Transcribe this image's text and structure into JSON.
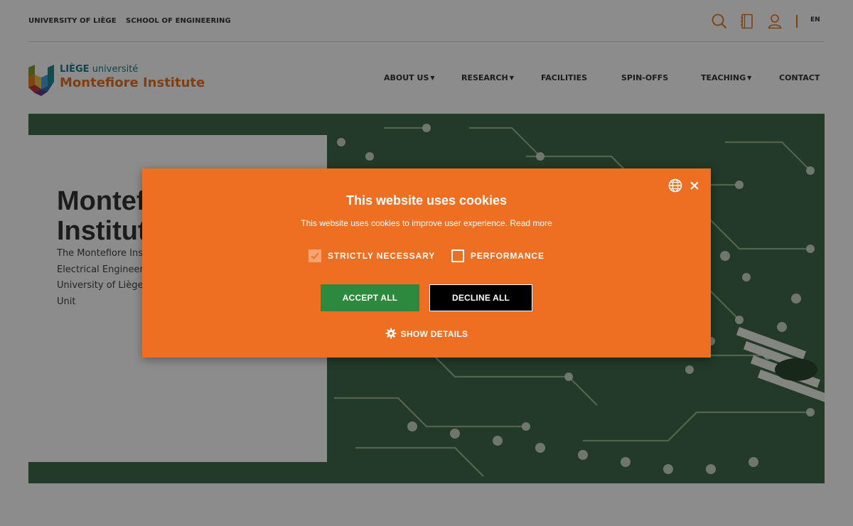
{
  "topbar": {
    "links": [
      "UNIVERSITY OF LIÈGE",
      "SCHOOL OF ENGINEERING"
    ],
    "language": "EN",
    "icons": [
      "search-icon",
      "book-icon",
      "user-icon"
    ],
    "accent_color": "#e07a1c"
  },
  "logo": {
    "university_bold": "LIÈGE",
    "university_rest": " université",
    "institute": "Montefiore Institute",
    "teal_color": "#1b7f86",
    "orange_color": "#e8731f"
  },
  "nav": {
    "items": [
      {
        "label": "ABOUT US",
        "dropdown": true
      },
      {
        "label": "RESEARCH",
        "dropdown": true
      },
      {
        "label": "FACILITIES",
        "dropdown": false
      },
      {
        "label": "SPIN-OFFS",
        "dropdown": false
      },
      {
        "label": "TEACHING",
        "dropdown": true
      },
      {
        "label": "CONTACT",
        "dropdown": false
      }
    ]
  },
  "hero": {
    "title_line1": "Montefi",
    "title_line2": "Institut",
    "text_lines": [
      "The Montefiore Inst",
      "Electrical Engineeri",
      "University of Liège,",
      "Unit"
    ]
  },
  "cookie": {
    "title": "This website uses cookies",
    "description": "This website uses cookies to improve user experience.",
    "read_more": "Read more",
    "options": [
      {
        "label": "STRICTLY NECESSARY",
        "checked": true,
        "disabled": true
      },
      {
        "label": "PERFORMANCE",
        "checked": false,
        "disabled": false
      }
    ],
    "accept_label": "ACCEPT ALL",
    "decline_label": "DECLINE ALL",
    "details_label": "SHOW DETAILS",
    "close_symbol": "×",
    "background_color": "#ef6f22",
    "accept_color": "#2c8a3f",
    "decline_color": "#000000"
  }
}
